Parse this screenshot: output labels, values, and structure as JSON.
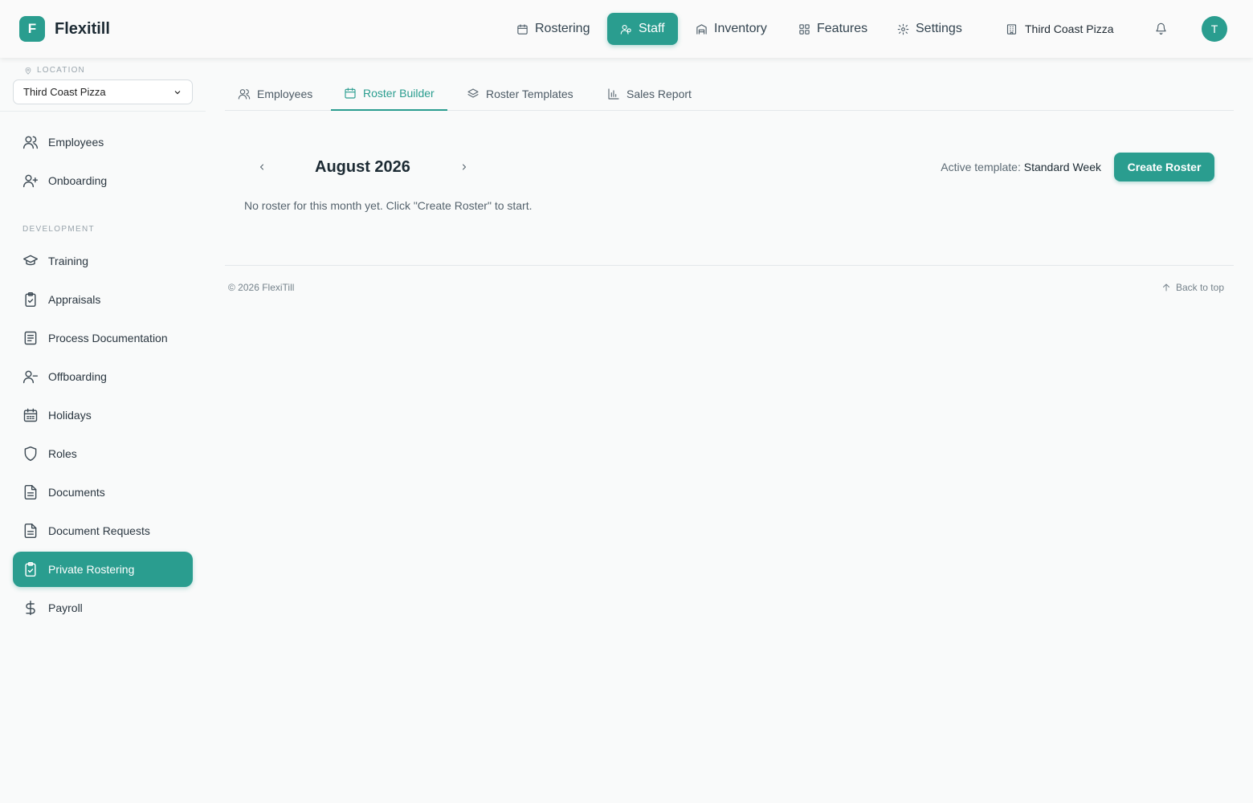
{
  "app": {
    "logo_letter": "F",
    "name": "Flexitill"
  },
  "topnav": {
    "items": [
      {
        "label": "Rostering",
        "icon": "calendar-icon"
      },
      {
        "label": "Staff",
        "icon": "users-icon",
        "active": true
      },
      {
        "label": "Inventory",
        "icon": "warehouse-icon"
      },
      {
        "label": "Features",
        "icon": "grid-icon"
      },
      {
        "label": "Settings",
        "icon": "gear-icon"
      }
    ],
    "organization": "Third Coast Pizza",
    "avatar_initial": "T"
  },
  "sidebar": {
    "location_label": "LOCATION",
    "location_value": "Third Coast Pizza",
    "section_development": "DEVELOPMENT",
    "items": [
      {
        "label": "Employees",
        "icon": "users-icon"
      },
      {
        "label": "Onboarding",
        "icon": "user-plus-icon"
      },
      {
        "label": "Training",
        "icon": "graduation-cap-icon"
      },
      {
        "label": "Appraisals",
        "icon": "clipboard-check-icon"
      },
      {
        "label": "Process Documentation",
        "icon": "book-icon"
      },
      {
        "label": "Offboarding",
        "icon": "user-minus-icon"
      },
      {
        "label": "Holidays",
        "icon": "calendar-days-icon"
      },
      {
        "label": "Roles",
        "icon": "shield-icon"
      },
      {
        "label": "Documents",
        "icon": "file-text-icon"
      },
      {
        "label": "Document Requests",
        "icon": "file-text-icon"
      },
      {
        "label": "Private Rostering",
        "icon": "clipboard-check-icon",
        "active": true
      },
      {
        "label": "Payroll",
        "icon": "dollar-icon"
      }
    ]
  },
  "tabs": [
    {
      "label": "Employees",
      "icon": "users-icon"
    },
    {
      "label": "Roster Builder",
      "icon": "calendar-icon",
      "active": true
    },
    {
      "label": "Roster Templates",
      "icon": "layers-icon"
    },
    {
      "label": "Sales Report",
      "icon": "bar-chart-icon"
    }
  ],
  "roster": {
    "month": "August 2026",
    "active_template_label": "Active template:",
    "active_template_value": "Standard Week",
    "create_button": "Create Roster",
    "empty_message": "No roster for this month yet. Click \"Create Roster\" to start."
  },
  "footer": {
    "copyright": "© 2026 FlexiTill",
    "back_to_top": "Back to top"
  },
  "colors": {
    "accent": "#2a9d8f",
    "background": "#f9fafa"
  }
}
